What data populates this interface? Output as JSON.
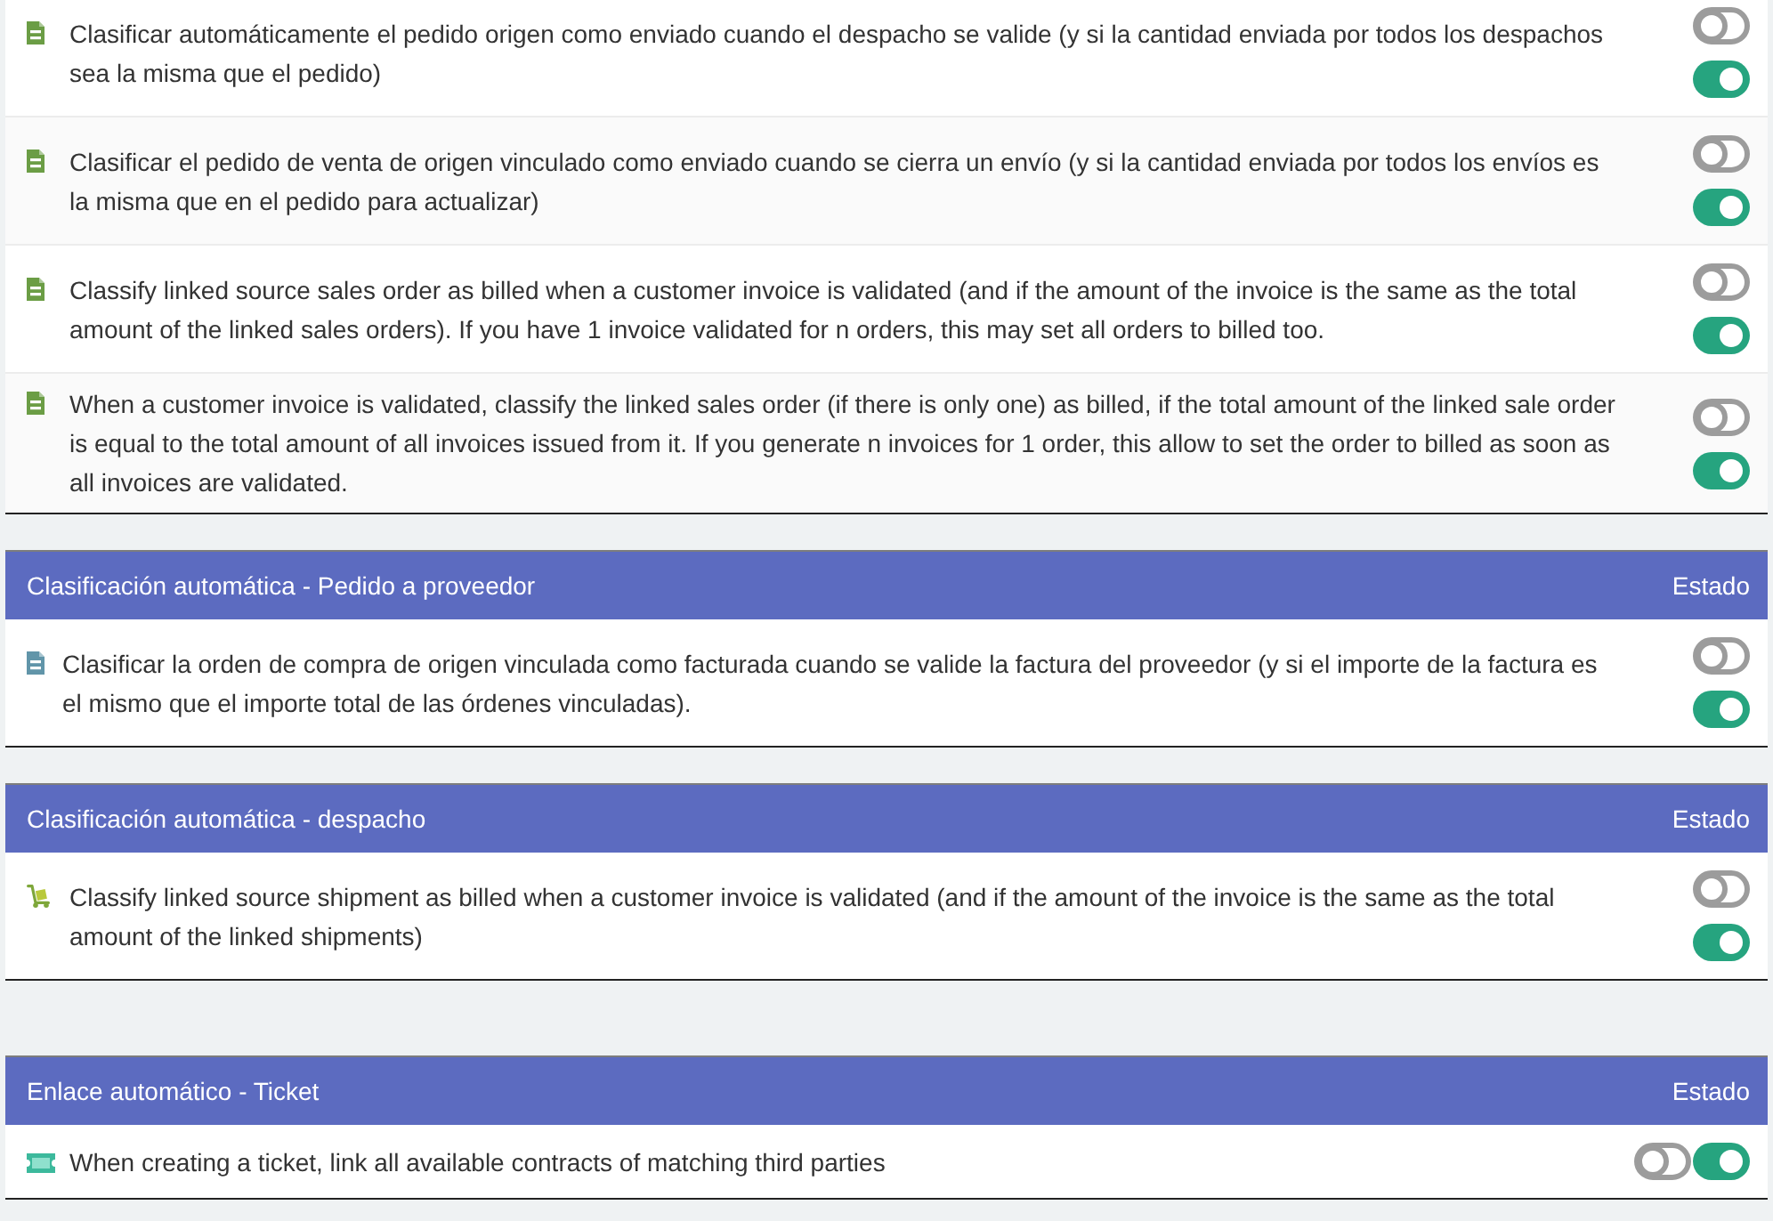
{
  "sections": [
    {
      "rows": [
        {
          "kind": "order",
          "text": "Clasificar automáticamente el pedido origen como enviado cuando el despacho se valide (y si la cantidad enviada por todos los despachos sea la misma que el pedido)",
          "toggles": [
            {
              "on": false
            },
            {
              "on": true
            }
          ]
        },
        {
          "kind": "order",
          "text": "Clasificar el pedido de venta de origen vinculado como enviado cuando se cierra un envío (y si la cantidad enviada por todos los envíos es la misma que en el pedido para actualizar)",
          "toggles": [
            {
              "on": false
            },
            {
              "on": true
            }
          ]
        },
        {
          "kind": "order",
          "text": "Classify linked source sales order as billed when a customer invoice is validated (and if the amount of the invoice is the same as the total amount of the linked sales orders). If you have 1 invoice validated for n orders, this may set all orders to billed too.",
          "toggles": [
            {
              "on": false
            },
            {
              "on": true
            }
          ]
        },
        {
          "kind": "order",
          "text": "When a customer invoice is validated, classify the linked sales order (if there is only one) as billed, if the total amount of the linked sale order is equal to the total amount of all invoices issued from it. If you generate n invoices for 1 order, this allow to set the order to billed as soon as all invoices are validated.",
          "toggles": [
            {
              "on": false
            },
            {
              "on": true
            }
          ]
        }
      ]
    },
    {
      "title": "Clasificación automática - Pedido a proveedor",
      "status_heading": "Estado",
      "rows": [
        {
          "kind": "supplier_order",
          "text": "Clasificar la orden de compra de origen vinculada como facturada cuando se valide la factura del proveedor (y si el importe de la factura es el mismo que el importe total de las órdenes vinculadas).",
          "toggles": [
            {
              "on": false
            },
            {
              "on": true
            }
          ]
        }
      ]
    },
    {
      "title": "Clasificación automática - despacho",
      "status_heading": "Estado",
      "rows": [
        {
          "kind": "shipment",
          "text": "Classify linked source shipment as billed when a customer invoice is validated (and if the amount of the invoice is the same as the total amount of the linked shipments)",
          "toggles": [
            {
              "on": false
            },
            {
              "on": true
            }
          ]
        }
      ]
    },
    {
      "title": "Enlace automático - Ticket",
      "status_heading": "Estado",
      "rows": [
        {
          "kind": "ticket",
          "text": "When creating a ticket, link all available contracts of matching third parties",
          "toggles": [
            {
              "on": false
            },
            {
              "on": true
            }
          ]
        }
      ]
    }
  ]
}
